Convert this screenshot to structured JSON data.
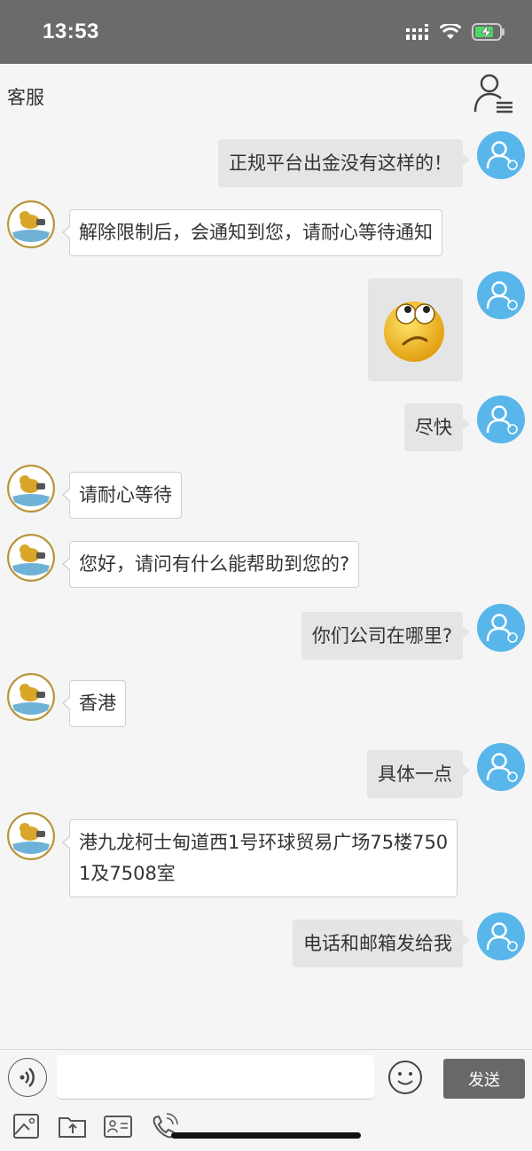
{
  "status_bar": {
    "time": "13:53"
  },
  "header": {
    "title": "客服"
  },
  "messages": [
    {
      "side": "right",
      "text": "正规平台出金没有这样的！"
    },
    {
      "side": "left",
      "text": "解除限制后，会通知到您，请耐心等待通知"
    },
    {
      "side": "right",
      "type": "emoji",
      "icon": "thinking-emoji-icon"
    },
    {
      "side": "right",
      "text": "尽快"
    },
    {
      "side": "left",
      "text": "请耐心等待"
    },
    {
      "side": "left",
      "text": "您好，请问有什么能帮助到您的?"
    },
    {
      "side": "right",
      "text": "你们公司在哪里?"
    },
    {
      "side": "left",
      "text": "香港"
    },
    {
      "side": "right",
      "text": "具体一点"
    },
    {
      "side": "left",
      "line1": "港九龙柯士甸道西1号环球贸易广场75楼750",
      "line2": "1及7508室"
    },
    {
      "side": "right",
      "text": "电话和邮箱发给我"
    }
  ],
  "input_bar": {
    "placeholder": "",
    "send_label": "发送"
  },
  "toolbar": {
    "items": [
      "image-icon",
      "folder-upload-icon",
      "contact-card-icon",
      "phone-call-icon"
    ]
  },
  "colors": {
    "status_bar": "#6b6b6b",
    "user_avatar": "#58b6ea",
    "send_button": "#686868",
    "battery": "#4cd964"
  }
}
